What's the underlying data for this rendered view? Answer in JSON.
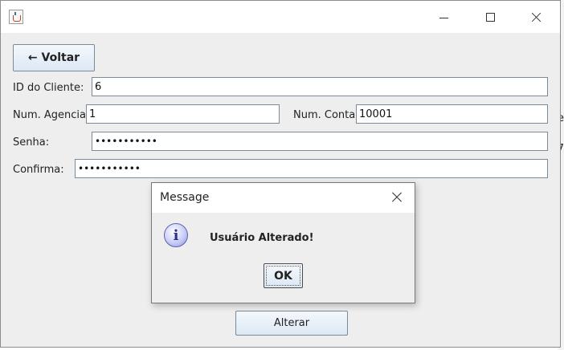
{
  "background": {
    "edge_text_1": "e",
    "edge_text_2": "7"
  },
  "window": {
    "title": ""
  },
  "form": {
    "back_button": "← Voltar",
    "client_id_label": "ID do Cliente:",
    "client_id_value": "6",
    "agency_label": "Num. Agencia:",
    "agency_value": "1",
    "account_label": "Num. Conta:",
    "account_value": "10001",
    "password_label": "Senha:",
    "password_value": "•••••••••••",
    "confirm_label": "Confirma:",
    "confirm_value": "•••••••••••",
    "submit_button": "Alterar"
  },
  "dialog": {
    "title": "Message",
    "icon_glyph": "i",
    "message": "Usuário Alterado!",
    "ok_button": "OK"
  },
  "icons": {
    "app": "java-cup-icon",
    "minimize": "minimize-icon",
    "maximize": "maximize-icon",
    "close": "close-icon",
    "info": "info-icon"
  }
}
